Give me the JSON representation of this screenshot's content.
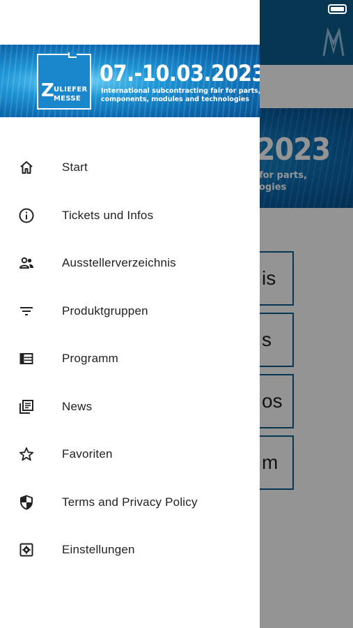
{
  "status_bar": {
    "battery_icon": "battery-icon"
  },
  "background": {
    "banner_date": "2023",
    "banner_sub_line1": "for parts,",
    "banner_sub_line2": "ogies",
    "buttons": [
      "is",
      "s",
      "os",
      "m"
    ]
  },
  "drawer": {
    "header": {
      "logo_letter": "Z",
      "logo_line1": "ULIEFER",
      "logo_line2": "MESSE",
      "date": "07.-10.03.2023",
      "subtitle_line1": "International subcontracting fair for parts,",
      "subtitle_line2": "components, modules and technologies"
    },
    "menu": [
      {
        "label": "Start",
        "icon": "home-icon"
      },
      {
        "label": "Tickets und Infos",
        "icon": "info-icon"
      },
      {
        "label": "Ausstellerverzeichnis",
        "icon": "people-icon"
      },
      {
        "label": "Produktgruppen",
        "icon": "filter-icon"
      },
      {
        "label": "Programm",
        "icon": "list-table-icon"
      },
      {
        "label": "News",
        "icon": "news-icon"
      },
      {
        "label": "Favoriten",
        "icon": "star-icon"
      },
      {
        "label": "Terms and Privacy Policy",
        "icon": "shield-icon"
      },
      {
        "label": "Einstellungen",
        "icon": "settings-icon"
      }
    ]
  }
}
